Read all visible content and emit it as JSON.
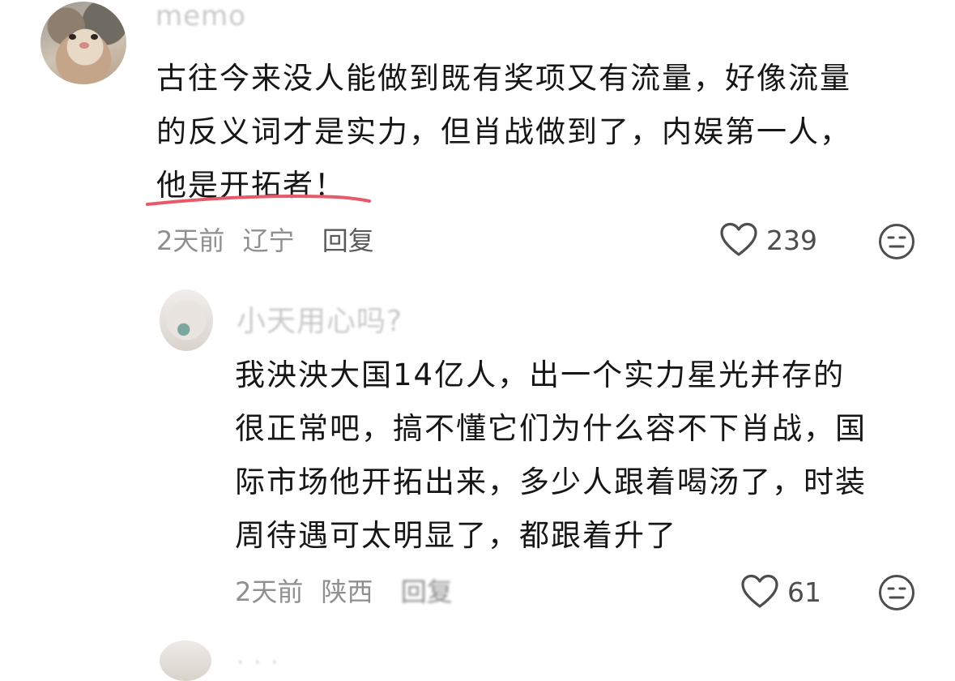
{
  "comments": [
    {
      "username": "memo",
      "text_lines": [
        "古往今来没人能做到既有奖项又有流量，好像流量",
        "的反义词才是实力，但肖战做到了，内娱第一人，",
        "他是开拓者！"
      ],
      "time": "2天前",
      "location": "辽宁",
      "reply_label": "回复",
      "likes": "239"
    },
    {
      "username": "小天用心吗?",
      "text_lines": [
        "我泱泱大国14亿人，出一个实力星光并存的",
        "很正常吧，搞不懂它们为什么容不下肖战，国",
        "际市场他开拓出来，多少人跟着喝汤了，时装",
        "周待遇可太明显了，都跟着升了"
      ],
      "time": "2天前",
      "location": "陕西",
      "reply_label": "回复",
      "likes": "61"
    },
    {
      "username": "· · ·"
    }
  ],
  "icons": {
    "like": "heart-outline-icon",
    "dislike": "neutral-face-icon"
  },
  "colors": {
    "underline": "#e65a6a",
    "meta_text": "#8f8f8f",
    "body_text": "#161616"
  }
}
